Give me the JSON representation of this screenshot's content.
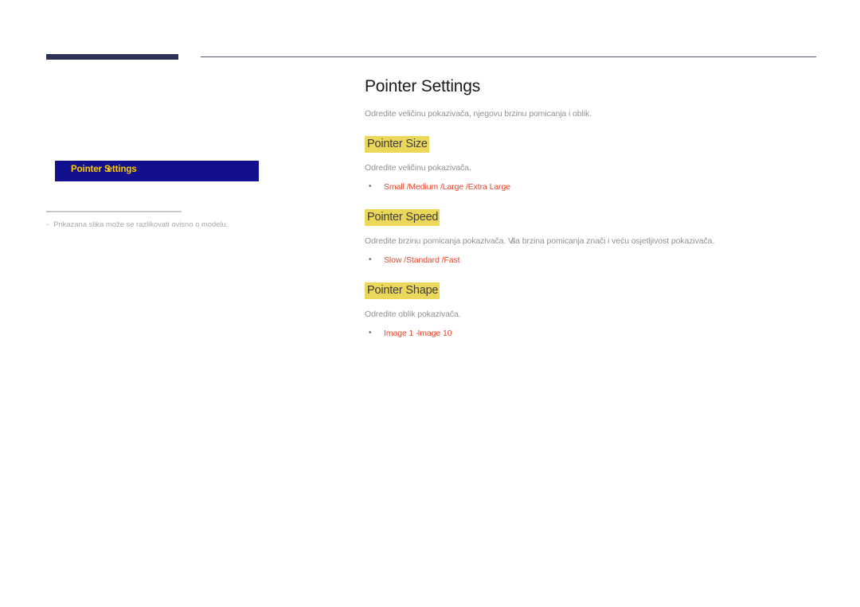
{
  "colors": {
    "header_bar": "#2c3256",
    "header_rule": "#535a77",
    "menu_box_bg": "#12108c",
    "menu_box_text": "#ffcc00",
    "highlight": "#ebd85a",
    "heading_text": "#3d3d3d",
    "option_text": "#e8452c",
    "body_text": "#919191",
    "title_text": "#1a1a1a",
    "note_text": "#a9a9a9",
    "divider": "#c9c9c9"
  },
  "left": {
    "menu_box_label_part1": "Pointer S",
    "menu_box_label_part2": "ettings",
    "note_dash": "-",
    "note_text": "Prikazana slika može se razlikovati ovisno o modelu."
  },
  "main": {
    "title": "Pointer Settings",
    "intro": "Odredite veličinu pokazivača, njegovu brzinu pomicanja i oblik.",
    "sections": [
      {
        "heading": "Pointer Size",
        "description": "Odredite veličinu pokazivača.",
        "bullet": "•",
        "options": "Small /Medium /Large /Extra Large"
      },
      {
        "heading": "Pointer Speed",
        "description_part1": "Odredite brzinu pomicanja pokazivača. Vi",
        "description_part2": "ša brzina pomicanja znači i veću osjetljivost pokazivača.",
        "bullet": "•",
        "options": "Slow /Standard /Fast"
      },
      {
        "heading": "Pointer Shape",
        "description": "Odredite oblik pokazivača.",
        "bullet": "•",
        "options_part1": "Image 1 -",
        "options_part2": "Image 10"
      }
    ]
  }
}
